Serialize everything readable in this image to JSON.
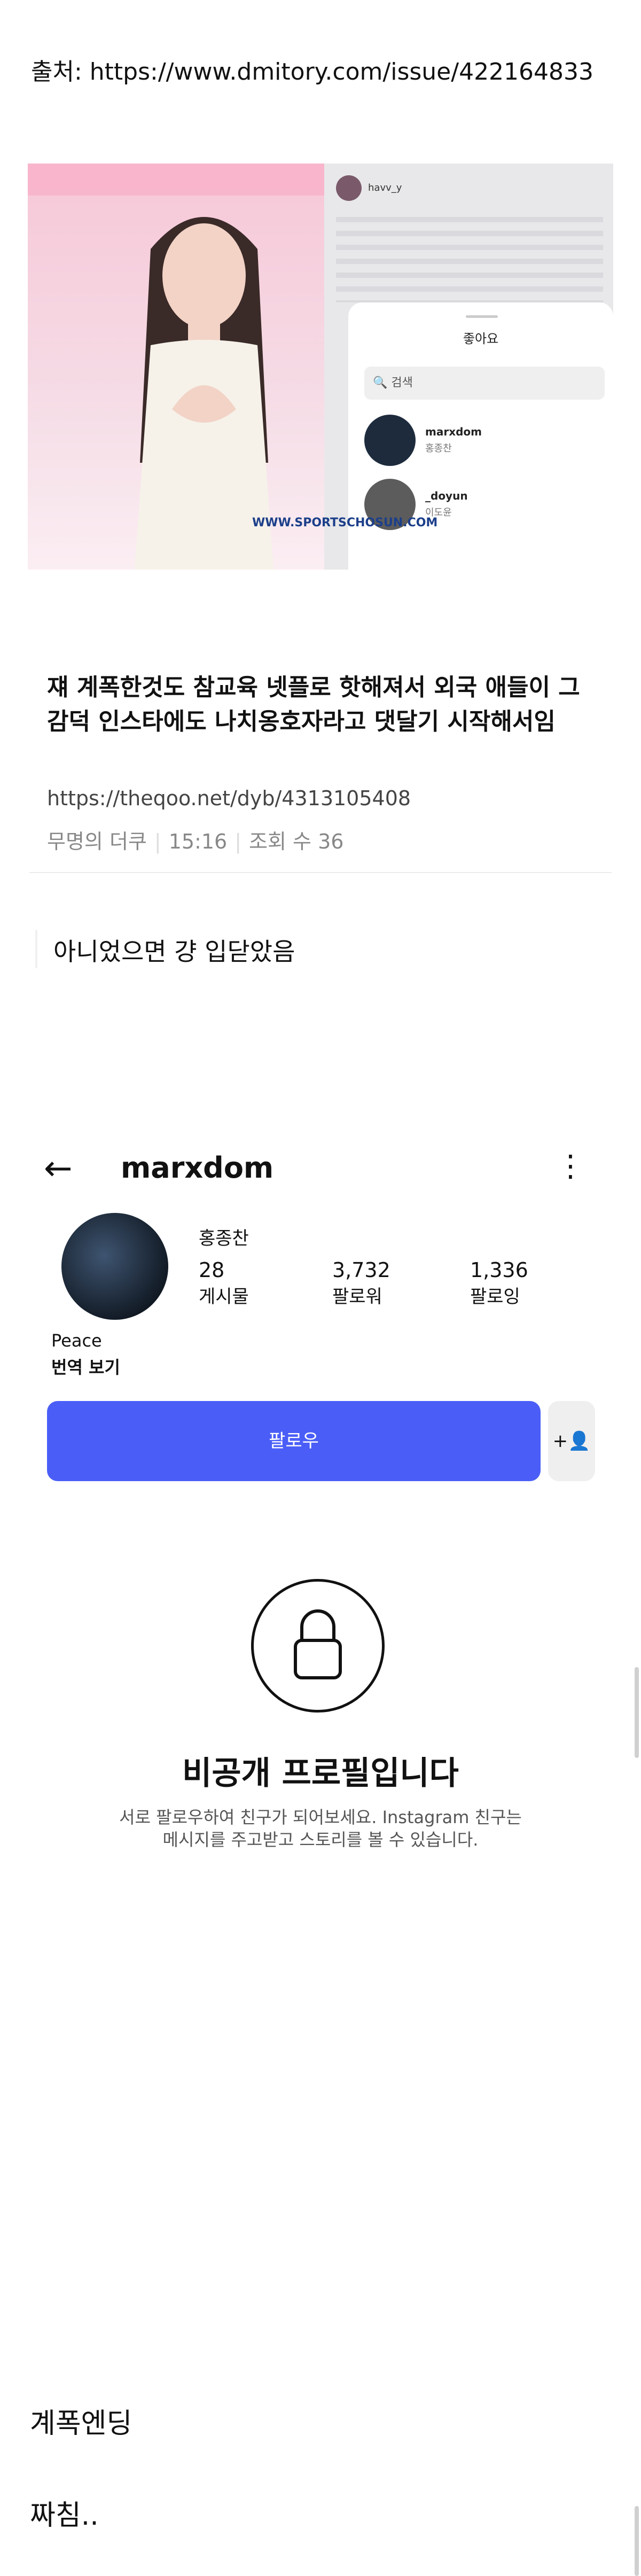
{
  "source": "출처: https://www.dmitory.com/issue/422164833",
  "photo": {
    "panel_username": "havv_y",
    "sheet_title": "좋아요",
    "search_placeholder": "검색",
    "users": [
      {
        "username": "marxdom",
        "name": "홍종찬"
      },
      {
        "username": "_doyun",
        "name": "이도윤"
      }
    ],
    "watermark": "WWW.SPORTSCHOSUN.COM"
  },
  "article": {
    "title": "쟤 계폭한것도 참교육 넷플로 핫해져서 외국 애들이 그 감덕 인스타에도 나치옹호자라고 댓달기 시작해서임",
    "url": "https://theqoo.net/dyb/4313105408",
    "author": "무명의 더쿠",
    "time": "15:16",
    "views": "조회 수 36"
  },
  "comment": "아니었으면 걍 입닫았음",
  "instagram": {
    "username": "marxdom",
    "name": "홍종찬",
    "stats": [
      {
        "value": "28",
        "label": "게시물"
      },
      {
        "value": "3,732",
        "label": "팔로워"
      },
      {
        "value": "1,336",
        "label": "팔로잉"
      }
    ],
    "bio": "Peace",
    "translate": "번역 보기",
    "follow_label": "팔로우",
    "private_title": "비공개 프로필입니다",
    "private_desc": "서로 팔로우하여 친구가 되어보세요. Instagram 친구는 메시지를 주고받고 스토리를 볼 수 있습니다."
  },
  "endings": [
    "계폭엔딩",
    "짜침.."
  ],
  "colors": {
    "follow": "#4a5ef7"
  }
}
